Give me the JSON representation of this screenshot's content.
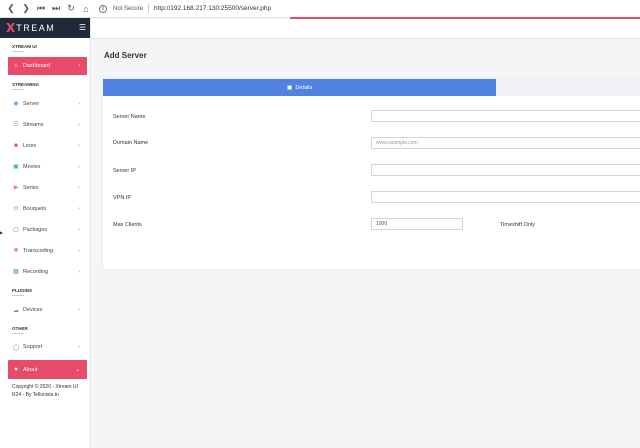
{
  "browser": {
    "security_label": "Not Secure",
    "url": "http://192.168.217.130:25500/server.php"
  },
  "colors": {
    "accent": "#e84b6a",
    "brand_bg": "#1e2a3a",
    "tab_active": "#5083e0"
  },
  "sidebar": {
    "brand_x": "X",
    "brand_rest": "TREAM",
    "sections": {
      "xtream_ui": "XTREAM UI",
      "streaming": "STREAMING",
      "plugins": "PLUGINS",
      "other": "OTHER"
    },
    "items": {
      "dashboard": {
        "label": "Dashboard",
        "icon": "home-icon"
      },
      "server": {
        "label": "Server",
        "icon": "server-icon"
      },
      "streams": {
        "label": "Streams",
        "icon": "streams-icon"
      },
      "lines": {
        "label": "Lines",
        "icon": "user-icon"
      },
      "movies": {
        "label": "Movies",
        "icon": "movie-icon"
      },
      "series": {
        "label": "Series",
        "icon": "video-icon"
      },
      "bouquets": {
        "label": "Bouquets",
        "icon": "bouquet-icon"
      },
      "packages": {
        "label": "Packages",
        "icon": "package-icon"
      },
      "transcoding": {
        "label": "Transcoding",
        "icon": "transcoding-icon"
      },
      "recording": {
        "label": "Recording",
        "icon": "recording-icon"
      },
      "devices": {
        "label": "Devices",
        "icon": "devices-icon"
      },
      "support": {
        "label": "Support",
        "icon": "support-icon"
      },
      "about": {
        "label": "About",
        "icon": "heart-icon"
      }
    },
    "copyright": "Copyright © 2020 - Xtream UI R24 - By Tellunisia.tn"
  },
  "main": {
    "page_title": "Add Server",
    "tabs": {
      "details": "Details"
    },
    "form": {
      "server_name_label": "Server Name",
      "domain_name_label": "Domain Name",
      "domain_name_placeholder": "www.example.com",
      "server_ip_label": "Server IP",
      "vpn_ip_label": "VPN IP",
      "max_clients_label": "Max Clients",
      "max_clients_value": "1000",
      "timeshift_label": "Timeshift Only"
    }
  }
}
